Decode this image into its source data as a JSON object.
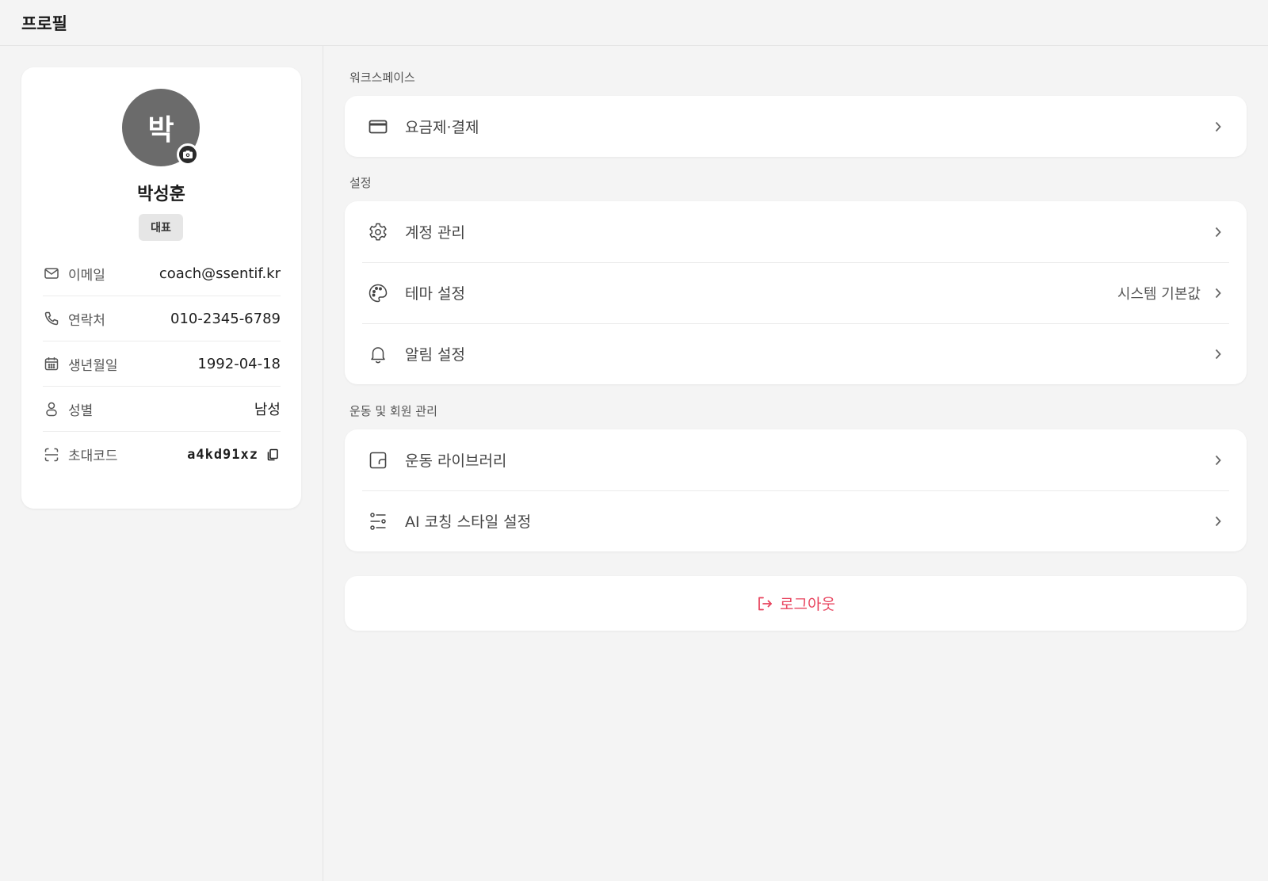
{
  "header": {
    "title": "프로필"
  },
  "profile": {
    "avatar_initial": "박",
    "name": "박성훈",
    "role": "대표",
    "info": [
      {
        "icon": "mail-icon",
        "label": "이메일",
        "value": "coach@ssentif.kr"
      },
      {
        "icon": "phone-icon",
        "label": "연락처",
        "value": "010-2345-6789"
      },
      {
        "icon": "calendar-icon",
        "label": "생년월일",
        "value": "1992-04-18"
      },
      {
        "icon": "person-icon",
        "label": "성별",
        "value": "남성"
      },
      {
        "icon": "scan-code-icon",
        "label": "초대코드",
        "value": "a4kd91xz"
      }
    ]
  },
  "sections": {
    "workspace": {
      "label": "워크스페이스",
      "items": [
        {
          "icon": "credit-card-icon",
          "label": "요금제·결제"
        }
      ]
    },
    "settings": {
      "label": "설정",
      "items": [
        {
          "icon": "gear-icon",
          "label": "계정 관리"
        },
        {
          "icon": "palette-icon",
          "label": "테마 설정",
          "value": "시스템 기본값"
        },
        {
          "icon": "bell-icon",
          "label": "알림 설정"
        }
      ]
    },
    "exercise": {
      "label": "운동 및 회원 관리",
      "items": [
        {
          "icon": "folder-icon",
          "label": "운동 라이브러리"
        },
        {
          "icon": "sliders-icon",
          "label": "AI 코칭 스타일 설정"
        }
      ]
    }
  },
  "logout": {
    "label": "로그아웃",
    "color": "#e8455f"
  }
}
